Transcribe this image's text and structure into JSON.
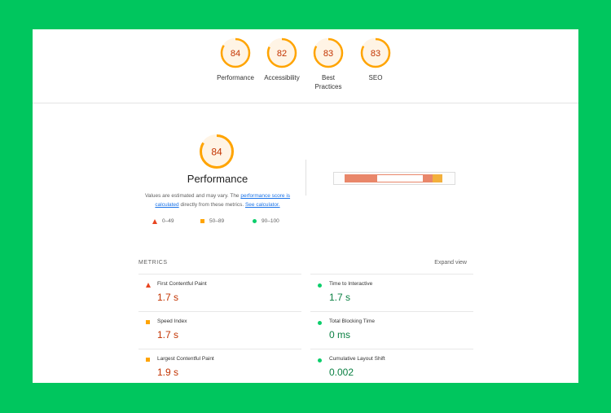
{
  "colors": {
    "background": "#00c65e",
    "gauge_average": "#ffa400",
    "gauge_text": "#c33300",
    "fail": "#e8441f",
    "pass": "#0cce6b",
    "value_orange": "#c33300",
    "value_green": "#0b8043"
  },
  "categories": [
    {
      "label": "Performance",
      "score": "84",
      "score_value": 84
    },
    {
      "label": "Accessibility",
      "score": "82",
      "score_value": 82
    },
    {
      "label": "Best Practices",
      "score": "83",
      "score_value": 83
    },
    {
      "label": "SEO",
      "score": "83",
      "score_value": 83
    }
  ],
  "performance": {
    "score": "84",
    "score_value": 84,
    "title": "Performance",
    "desc_prefix": "Values are estimated and may vary. The ",
    "desc_link1": "performance score is calculated",
    "desc_middle": " directly from these metrics. ",
    "desc_link2": "See calculator."
  },
  "legend": [
    {
      "icon": "triangle-icon",
      "label": "0–49"
    },
    {
      "icon": "square-icon",
      "label": "50–89"
    },
    {
      "icon": "circle-icon",
      "label": "90–100"
    }
  ],
  "metrics": {
    "heading": "METRICS",
    "expand_label": "Expand view",
    "items": [
      {
        "name": "First Contentful Paint",
        "value": "1.7 s",
        "rating": "fail"
      },
      {
        "name": "Time to Interactive",
        "value": "1.7 s",
        "rating": "pass"
      },
      {
        "name": "Speed Index",
        "value": "1.7 s",
        "rating": "average"
      },
      {
        "name": "Total Blocking Time",
        "value": "0 ms",
        "rating": "pass"
      },
      {
        "name": "Largest Contentful Paint",
        "value": "1.9 s",
        "rating": "average"
      },
      {
        "name": "Cumulative Layout Shift",
        "value": "0.002",
        "rating": "pass"
      }
    ]
  }
}
